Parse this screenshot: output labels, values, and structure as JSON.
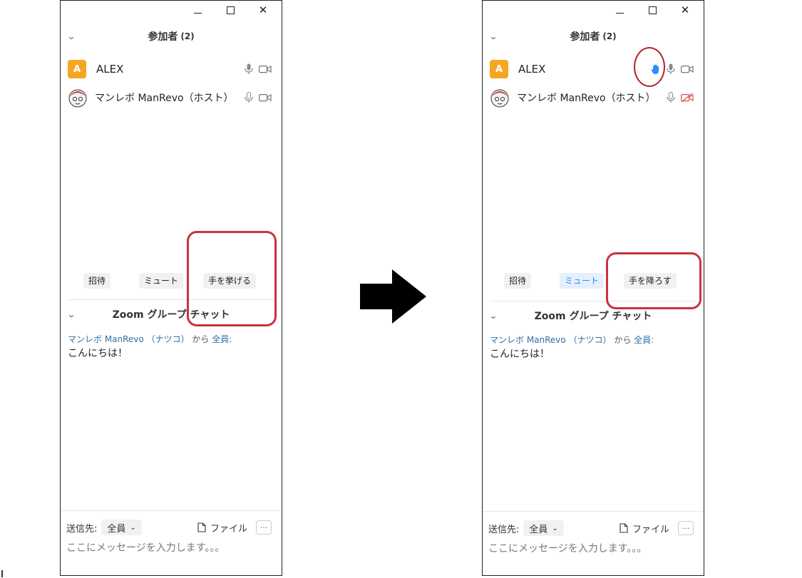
{
  "window_controls": [
    "—",
    "☐",
    "✕"
  ],
  "participants_header": {
    "title": "参加者",
    "count": "(2)"
  },
  "participants": [
    {
      "avatar_letter": "A",
      "name": "ALEX",
      "avatar_color": "#f5a623"
    },
    {
      "name": "マンレボ ManRevo（ホスト）"
    }
  ],
  "left": {
    "buttons": {
      "invite": "招待",
      "mute": "ミュート",
      "raise_hand": "手を挙げる"
    }
  },
  "right": {
    "buttons": {
      "invite": "招待",
      "mute": "ミュート",
      "lower_hand": "手を降ろす"
    }
  },
  "chat_header": {
    "title": "Zoom グループ チャット"
  },
  "chat_message": {
    "sender": "マンレボ ManRevo （ナツコ）",
    "from_word": "から",
    "recipient": "全員:",
    "text": "こんにちは！"
  },
  "chat_input": {
    "to_label": "送信先:",
    "to_value": "全員",
    "file_label": "ファイル",
    "more_label": "···",
    "placeholder": "ここにメッセージを入力します。。。"
  },
  "colors": {
    "accent_blue": "#2d8cff",
    "highlight_red": "#c8333e",
    "avatar_orange": "#f5a623",
    "video_off_red": "#d9534f"
  },
  "icons": [
    "microphone-icon",
    "video-camera-icon",
    "video-off-icon",
    "raised-hand-icon",
    "file-icon",
    "chevron-down-icon",
    "arrow-right-icon"
  ]
}
